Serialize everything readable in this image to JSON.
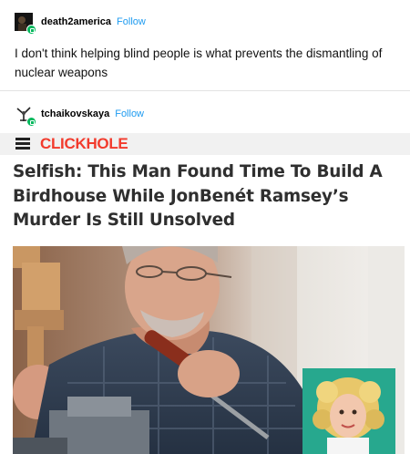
{
  "post1": {
    "username": "death2america",
    "follow_label": "Follow",
    "text": "I don't think helping blind people is what prevents the dismantling of nuclear weapons"
  },
  "post2": {
    "username": "tchaikovskaya",
    "follow_label": "Follow",
    "site_logo": "CLICKHOLE",
    "headline": "Selfish: This Man Found Time To Build A Birdhouse While JonBenét Ramsey’s Murder Is Still Unsolved"
  },
  "colors": {
    "follow": "#1e9bf0",
    "badge": "#00b85c",
    "clickhole_red": "#f23b2d",
    "headline": "#2f2f2f"
  },
  "icons": [
    "menu-icon",
    "avatar-badge-icon"
  ]
}
